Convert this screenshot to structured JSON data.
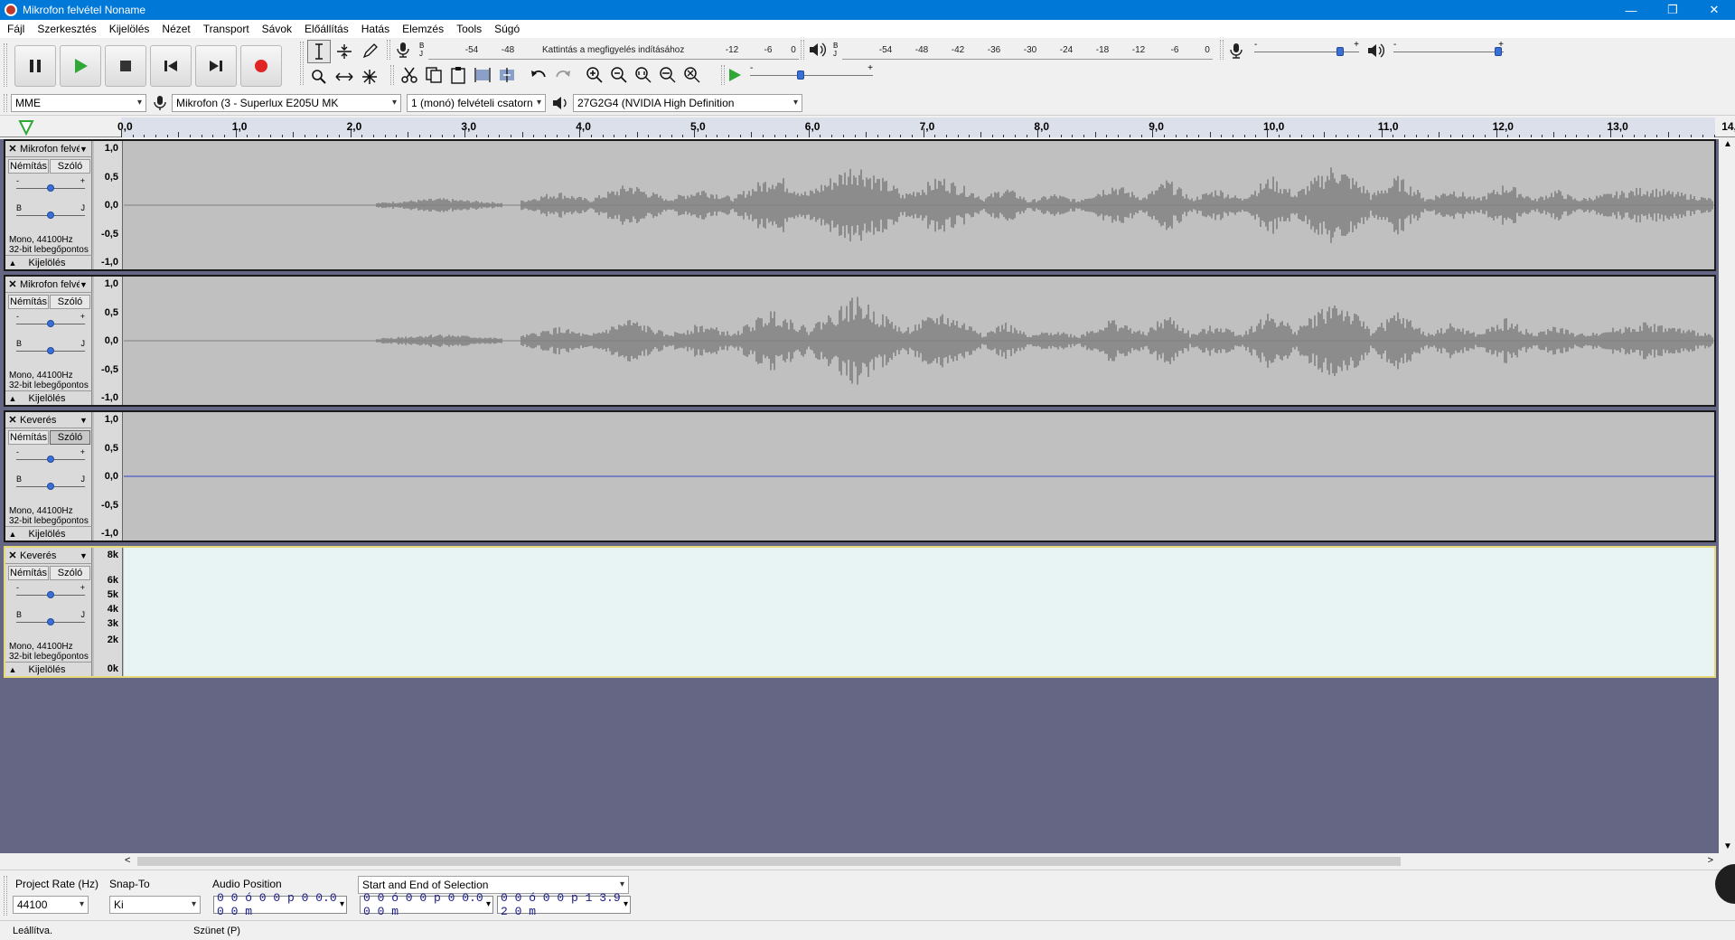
{
  "window": {
    "title": "Mikrofon felvétel Noname",
    "minimize": "—",
    "restore": "❐",
    "close": "✕"
  },
  "menu": [
    "Fájl",
    "Szerkesztés",
    "Kijelölés",
    "Nézet",
    "Transport",
    "Sávok",
    "Előállítás",
    "Hatás",
    "Elemzés",
    "Tools",
    "Súgó"
  ],
  "record_meter": {
    "channels_top": "B",
    "channels_bottom": "J",
    "hint": "Kattintás a megfigyelés indításához",
    "ticks": [
      "-54",
      "-48",
      "-12",
      "-6",
      "0"
    ]
  },
  "playback_meter": {
    "channels_top": "B",
    "channels_bottom": "J",
    "ticks": [
      "-54",
      "-48",
      "-42",
      "-36",
      "-30",
      "-24",
      "-18",
      "-12",
      "-6",
      "0"
    ]
  },
  "mixer": {
    "minus": "-",
    "plus": "+",
    "record_volume": 0.86,
    "playback_volume": 1.0,
    "play_speed": 0.4
  },
  "devices": {
    "host": "MME",
    "recording_device": "Mikrofon (3 - Superlux E205U MK",
    "channels": "1 (monó) felvételi csatorn",
    "playback_device": "27G2G4 (NVIDIA High Definition"
  },
  "ruler": {
    "labels": [
      "0,0",
      "1,0",
      "2,0",
      "3,0",
      "4,0",
      "5,0",
      "6,0",
      "7,0",
      "8,0",
      "9,0",
      "10,0",
      "11,0",
      "12,0",
      "13,0",
      "14,0"
    ]
  },
  "tracks": [
    {
      "name": "Mikrofon felvé",
      "close": "✕",
      "mute": "Némítás",
      "solo": "Szóló",
      "gain_minus": "-",
      "gain_plus": "+",
      "pan_left": "B",
      "pan_right": "J",
      "info_line1": "Mono, 44100Hz",
      "info_line2": "32-bit lebegőpontos",
      "select": "Kijelölés",
      "scale": [
        "1,0",
        "0,5",
        "0,0",
        "-0,5",
        "-1,0"
      ],
      "view": "waveform"
    },
    {
      "name": "Mikrofon felvé",
      "close": "✕",
      "mute": "Némítás",
      "solo": "Szóló",
      "gain_minus": "-",
      "gain_plus": "+",
      "pan_left": "B",
      "pan_right": "J",
      "info_line1": "Mono, 44100Hz",
      "info_line2": "32-bit lebegőpontos",
      "select": "Kijelölés",
      "scale": [
        "1,0",
        "0,5",
        "0,0",
        "-0,5",
        "-1,0"
      ],
      "view": "waveform"
    },
    {
      "name": "Keverés",
      "close": "✕",
      "mute": "Némítás",
      "solo": "Szóló",
      "gain_minus": "-",
      "gain_plus": "+",
      "pan_left": "B",
      "pan_right": "J",
      "info_line1": "Mono, 44100Hz",
      "info_line2": "32-bit lebegőpontos",
      "select": "Kijelölés",
      "scale": [
        "1,0",
        "0,5",
        "0,0",
        "-0,5",
        "-1,0"
      ],
      "view": "flat"
    },
    {
      "name": "Keverés",
      "close": "✕",
      "mute": "Némítás",
      "solo": "Szóló",
      "gain_minus": "-",
      "gain_plus": "+",
      "pan_left": "B",
      "pan_right": "J",
      "info_line1": "Mono, 44100Hz",
      "info_line2": "32-bit lebegőpontos",
      "select": "Kijelölés",
      "scale": [
        "8k",
        "6k",
        "5k",
        "4k",
        "3k",
        "2k",
        "0k"
      ],
      "view": "spectrogram"
    }
  ],
  "selection_toolbar": {
    "project_rate_label": "Project Rate (Hz)",
    "project_rate": "44100",
    "snap_to_label": "Snap-To",
    "snap_to": "Ki",
    "audio_position_label": "Audio Position",
    "audio_position": "0 0 ó 0 0 p 0 0.0 0 0 m",
    "selection_mode": "Start and End of Selection",
    "selection_start": "0 0 ó 0 0 p 0 0.0 0 0 m",
    "selection_end": "0 0 ó 0 0 p 1 3.9 2 0 m"
  },
  "status": {
    "state": "Leállítva.",
    "hint": "Szünet (P)"
  },
  "colors": {
    "titlebar": "#0078d7",
    "waveform": "#7f7f7f",
    "track_bg": "#646684",
    "flat_line": "#3040c0"
  }
}
